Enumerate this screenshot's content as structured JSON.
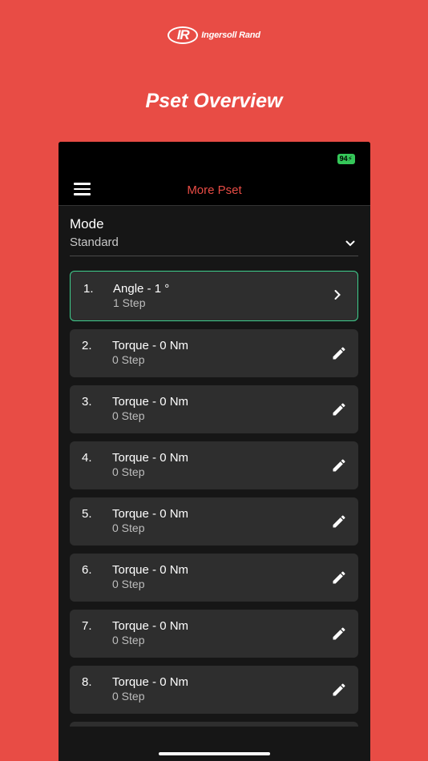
{
  "brand": {
    "mark": "IR",
    "name": "Ingersoll Rand"
  },
  "headline": "Pset Overview",
  "status": {
    "battery": "94"
  },
  "header": {
    "title": "More Pset",
    "menu_icon": "hamburger-icon"
  },
  "mode": {
    "label": "Mode",
    "value": "Standard",
    "icon": "chevron-down-icon"
  },
  "psets": [
    {
      "num": "1.",
      "title": "Angle - 1 °",
      "sub": "1 Step",
      "icon": "chevron-right-icon",
      "selected": true
    },
    {
      "num": "2.",
      "title": "Torque - 0 Nm",
      "sub": "0 Step",
      "icon": "pencil-icon"
    },
    {
      "num": "3.",
      "title": "Torque - 0 Nm",
      "sub": "0 Step",
      "icon": "pencil-icon"
    },
    {
      "num": "4.",
      "title": "Torque - 0 Nm",
      "sub": "0 Step",
      "icon": "pencil-icon"
    },
    {
      "num": "5.",
      "title": "Torque - 0 Nm",
      "sub": "0 Step",
      "icon": "pencil-icon"
    },
    {
      "num": "6.",
      "title": "Torque - 0 Nm",
      "sub": "0 Step",
      "icon": "pencil-icon"
    },
    {
      "num": "7.",
      "title": "Torque - 0 Nm",
      "sub": "0 Step",
      "icon": "pencil-icon"
    },
    {
      "num": "8.",
      "title": "Torque - 0 Nm",
      "sub": "0 Step",
      "icon": "pencil-icon"
    }
  ],
  "colors": {
    "background": "#E84C45",
    "accent": "#E84C45",
    "selected_border": "#3FCF8E",
    "battery": "#35C759"
  }
}
